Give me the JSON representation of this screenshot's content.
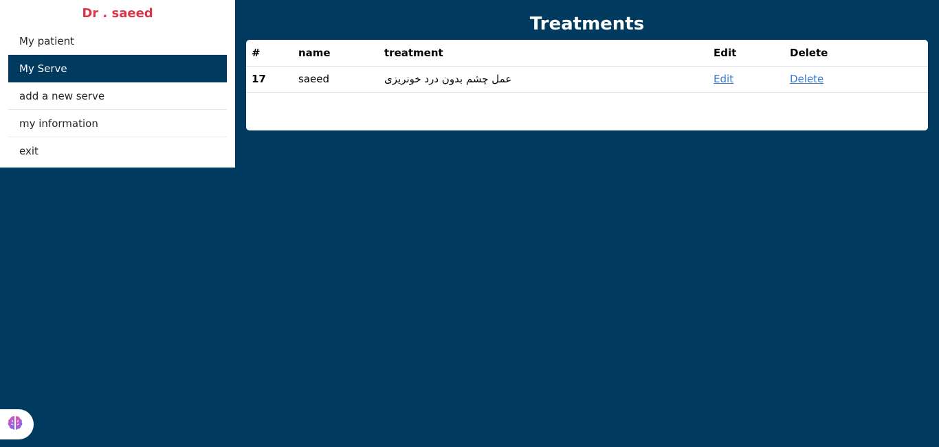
{
  "sidebar": {
    "title": "Dr . saeed",
    "items": [
      {
        "label": "My patient",
        "active": false
      },
      {
        "label": "My Serve",
        "active": true
      },
      {
        "label": "add a new serve",
        "active": false
      },
      {
        "label": "my information",
        "active": false
      },
      {
        "label": "exit",
        "active": false
      }
    ]
  },
  "main": {
    "title": "Treatments",
    "table": {
      "headers": [
        "#",
        "name",
        "treatment",
        "Edit",
        "Delete"
      ],
      "rows": [
        {
          "id": "17",
          "name": "saeed",
          "treatment": "عمل چشم بدون درد خونریزی",
          "edit": "Edit",
          "delete": "Delete"
        }
      ]
    }
  },
  "colors": {
    "background": "#003a5e",
    "accent_title": "#dc3545",
    "link": "#3a7bd5"
  },
  "floating_button": {
    "icon": "brain-icon"
  }
}
